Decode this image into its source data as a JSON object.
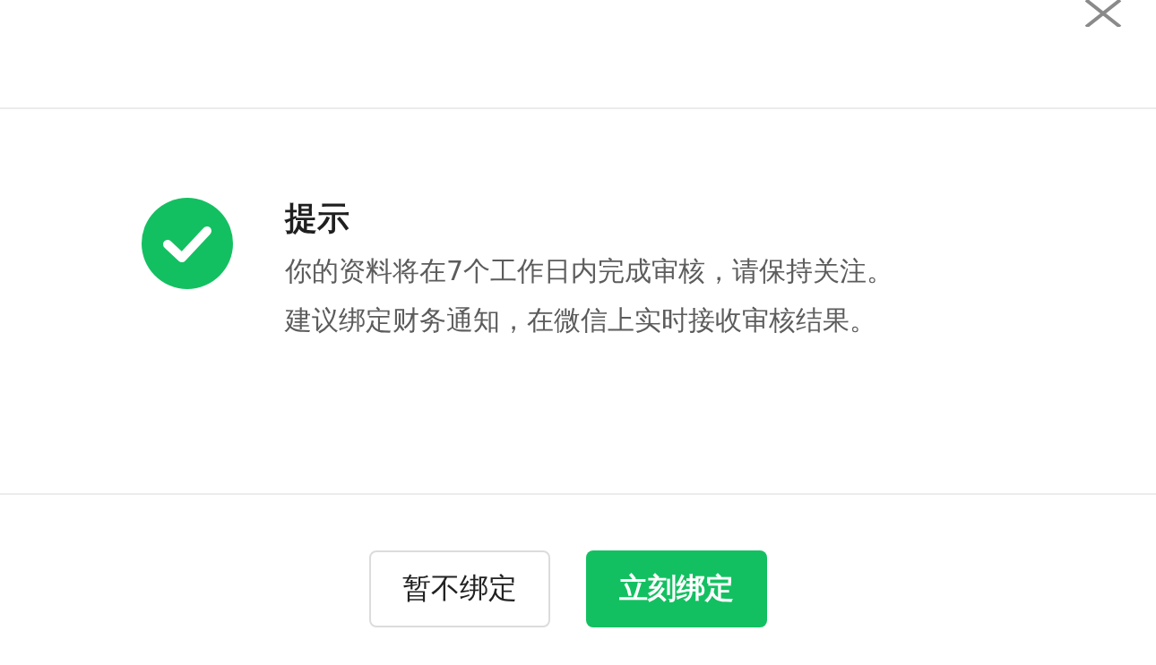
{
  "dialog": {
    "title": "提示",
    "message_lines": [
      "你的资料将在7个工作日内完成审核，请保持关注。",
      "建议绑定财务通知，在微信上实时接收审核结果。"
    ],
    "buttons": [
      {
        "label": "暂不绑定",
        "kind": "secondary"
      },
      {
        "label": "立刻绑定",
        "kind": "primary"
      }
    ]
  }
}
